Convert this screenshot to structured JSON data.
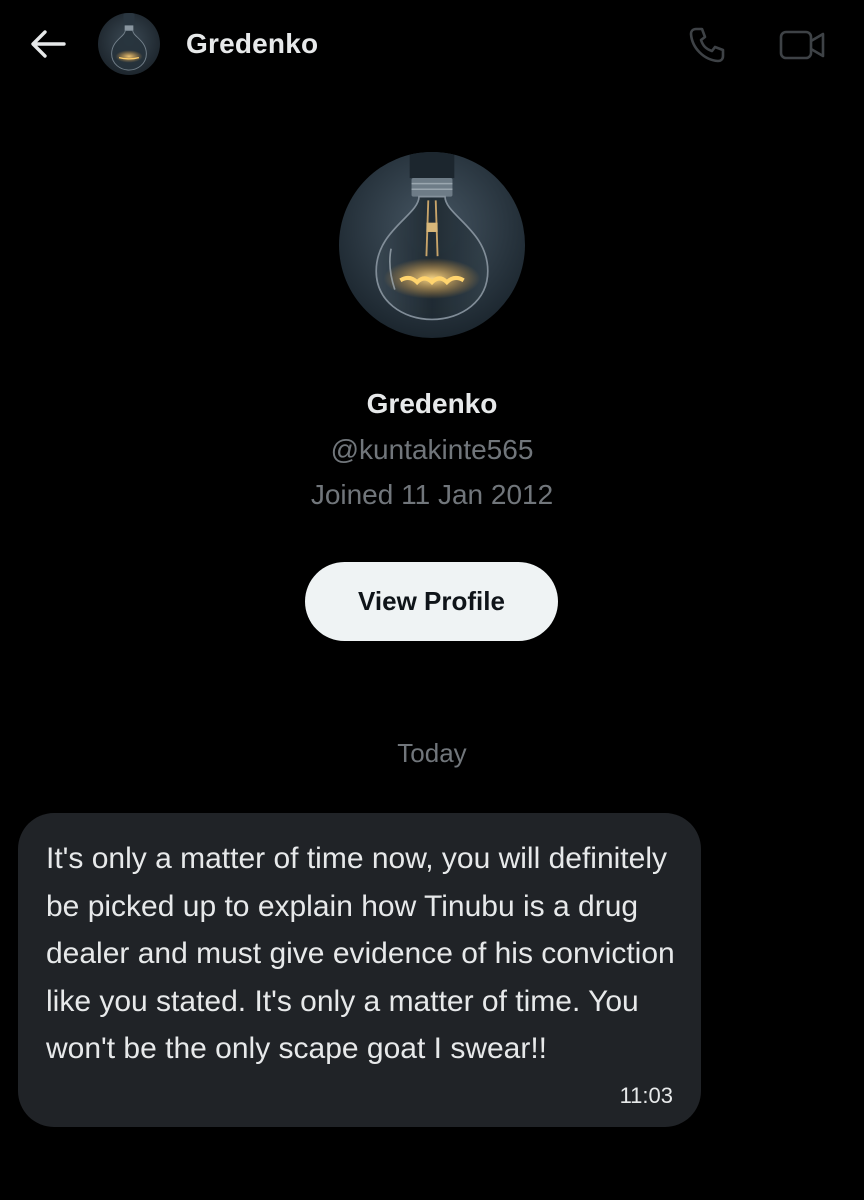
{
  "header": {
    "back_icon": "arrow-left-icon",
    "name": "Gredenko",
    "call_icon": "phone-icon",
    "video_icon": "video-camera-icon"
  },
  "profile": {
    "name": "Gredenko",
    "handle": "@kuntakinte565",
    "joined": "Joined 11 Jan 2012",
    "view_profile_label": "View Profile",
    "avatar": "lightbulb-avatar"
  },
  "conversation": {
    "day_label": "Today",
    "messages": [
      {
        "text": "It's only a matter of time now, you will definitely be picked up to explain how Tinubu is a drug dealer and must give evidence of his conviction like you stated. It's only a matter of time. You won't be the only scape goat I swear!!",
        "time": "11:03"
      }
    ]
  },
  "colors": {
    "background": "#000000",
    "primary_text": "#e7e9ea",
    "secondary_text": "#71767b",
    "bubble": "#202327",
    "button_bg": "#eff3f4",
    "button_text": "#0f1419"
  }
}
